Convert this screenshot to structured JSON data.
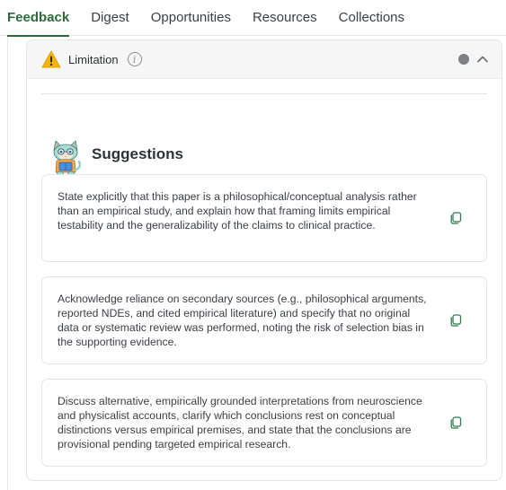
{
  "tabs": [
    {
      "label": "Feedback",
      "active": true
    },
    {
      "label": "Digest",
      "active": false
    },
    {
      "label": "Opportunities",
      "active": false
    },
    {
      "label": "Resources",
      "active": false
    },
    {
      "label": "Collections",
      "active": false
    }
  ],
  "card": {
    "header_label": "Limitation",
    "info_glyph": "i",
    "header_icon": "warning-icon",
    "status_dot_color": "#7d8085"
  },
  "suggestions": {
    "title": "Suggestions",
    "items": [
      {
        "text": "State explicitly that this paper is a philosophical/conceptual analysis rather than an empirical study, and explain how that framing limits empirical testability and the generalizability of the claims to clinical practice."
      },
      {
        "text": "Acknowledge reliance on secondary sources (e.g., philosophical arguments, reported NDEs, and cited empirical literature) and specify that no original data or systematic review was performed, noting the risk of selection bias in the supporting evidence."
      },
      {
        "text": "Discuss alternative, empirically grounded interpretations from neuroscience and physicalist accounts, clarify which conclusions rest on conceptual distinctions versus empirical premises, and state that the conclusions are provisional pending targeted empirical research."
      }
    ]
  },
  "colors": {
    "accent": "#2e6b3c",
    "warning": "#f4b400",
    "copy_icon": "#2e7d4a"
  }
}
